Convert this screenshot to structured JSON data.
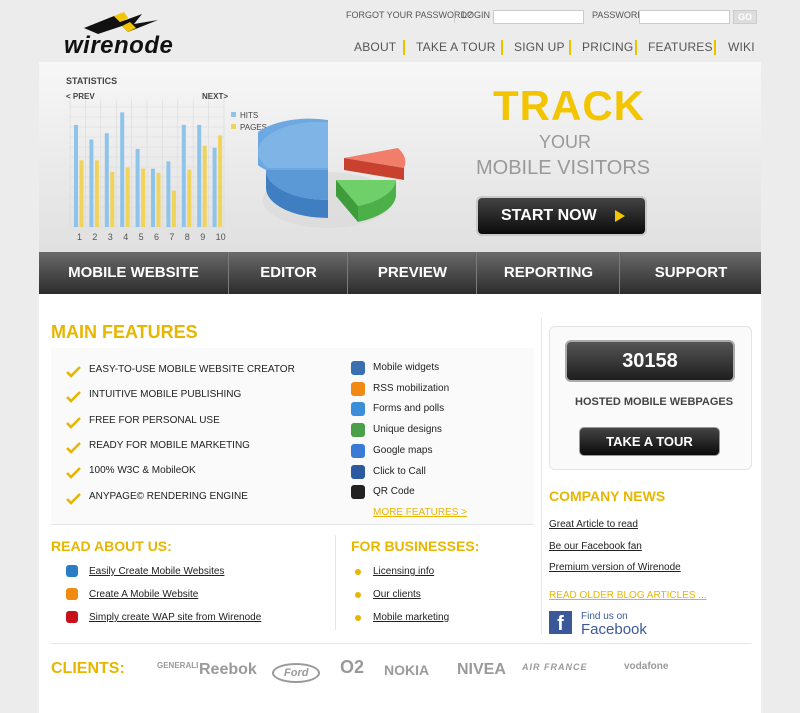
{
  "header": {
    "logo_text": "wirenode",
    "forgot_password": "FORGOT YOUR PASSWORD?",
    "login_label": "LOGIN",
    "password_label": "PASSWORD",
    "go_label": "GO",
    "nav": [
      "ABOUT",
      "TAKE A TOUR",
      "SIGN UP",
      "PRICING",
      "FEATURES",
      "WIKI"
    ]
  },
  "hero": {
    "stats_title": "STATISTICS",
    "prev": "< PREV",
    "next": "NEXT>",
    "legend_hits": "HITS",
    "legend_pages": "PAGES",
    "x_labels": [
      "1",
      "2",
      "3",
      "4",
      "5",
      "6",
      "7",
      "8",
      "9",
      "10"
    ],
    "track": "TRACK",
    "your": "YOUR",
    "mobile_visitors": "MOBILE VISITORS",
    "start_now": "START NOW"
  },
  "chart_data": {
    "type": "bar",
    "categories": [
      "1",
      "2",
      "3",
      "4",
      "5",
      "6",
      "7",
      "8",
      "9",
      "10"
    ],
    "series": [
      {
        "name": "HITS",
        "values": [
          98,
          84,
          90,
          110,
          75,
          56,
          63,
          98,
          98,
          76
        ]
      },
      {
        "name": "PAGES",
        "values": [
          64,
          64,
          53,
          57,
          56,
          52,
          35,
          55,
          78,
          88
        ]
      }
    ],
    "colors": {
      "HITS": "#8ec4ea",
      "PAGES": "#f0d35a"
    }
  },
  "darkbar": [
    "MOBILE WEBSITE",
    "EDITOR",
    "PREVIEW",
    "REPORTING",
    "SUPPORT"
  ],
  "main_features": {
    "title": "MAIN FEATURES",
    "items": [
      "EASY-TO-USE MOBILE WEBSITE CREATOR",
      "INTUITIVE MOBILE PUBLISHING",
      "FREE FOR PERSONAL USE",
      "READY FOR MOBILE MARKETING",
      "100% W3C & MobileOK",
      "ANYPAGE© RENDERING ENGINE"
    ],
    "widgets": [
      {
        "label": "Mobile widgets",
        "icon": "phone-icon",
        "color": "#3a6fb0"
      },
      {
        "label": "RSS mobilization",
        "icon": "rss-icon",
        "color": "#f08a12"
      },
      {
        "label": "Forms and polls",
        "icon": "chat-bubbles-icon",
        "color": "#3b8fd8"
      },
      {
        "label": "Unique designs",
        "icon": "brush-icon",
        "color": "#4aa04a"
      },
      {
        "label": "Google maps",
        "icon": "globe-icon",
        "color": "#3a7bd5"
      },
      {
        "label": "Click to Call",
        "icon": "call-icon",
        "color": "#2c5aa0"
      },
      {
        "label": "QR Code",
        "icon": "qr-code-icon",
        "color": "#222222"
      }
    ],
    "more": "MORE FEATURES >"
  },
  "stats_box": {
    "count": "30158",
    "caption": "HOSTED MOBILE WEBPAGES",
    "tour_btn": "TAKE A TOUR"
  },
  "company_news": {
    "title": "COMPANY NEWS",
    "items": [
      "Great Article to read",
      "Be our Facebook fan",
      "Premium version of Wirenode"
    ],
    "older": "READ OLDER BLOG ARTICLES ...",
    "fb_line1": "Find us on",
    "fb_line2": "Facebook"
  },
  "read_about": {
    "title": "READ ABOUT US:",
    "items": [
      {
        "label": "Easily Create Mobile Websites",
        "icon": "cn-icon",
        "color": "#2a7cc7"
      },
      {
        "label": "Create A Mobile Website",
        "icon": "blog-icon",
        "color": "#f08a12"
      },
      {
        "label": "Simply create WAP site from Wirenode",
        "icon": "flash-icon",
        "color": "#c8101a"
      }
    ]
  },
  "businesses": {
    "title": "FOR BUSINESSES:",
    "items": [
      "Licensing info",
      "Our clients",
      "Mobile marketing"
    ]
  },
  "clients": {
    "title": "CLIENTS:",
    "logos": [
      "GENERALI",
      "Reebok",
      "Ford",
      "O2",
      "NOKIA",
      "NIVEA",
      "AIR FRANCE",
      "vodafone"
    ]
  }
}
